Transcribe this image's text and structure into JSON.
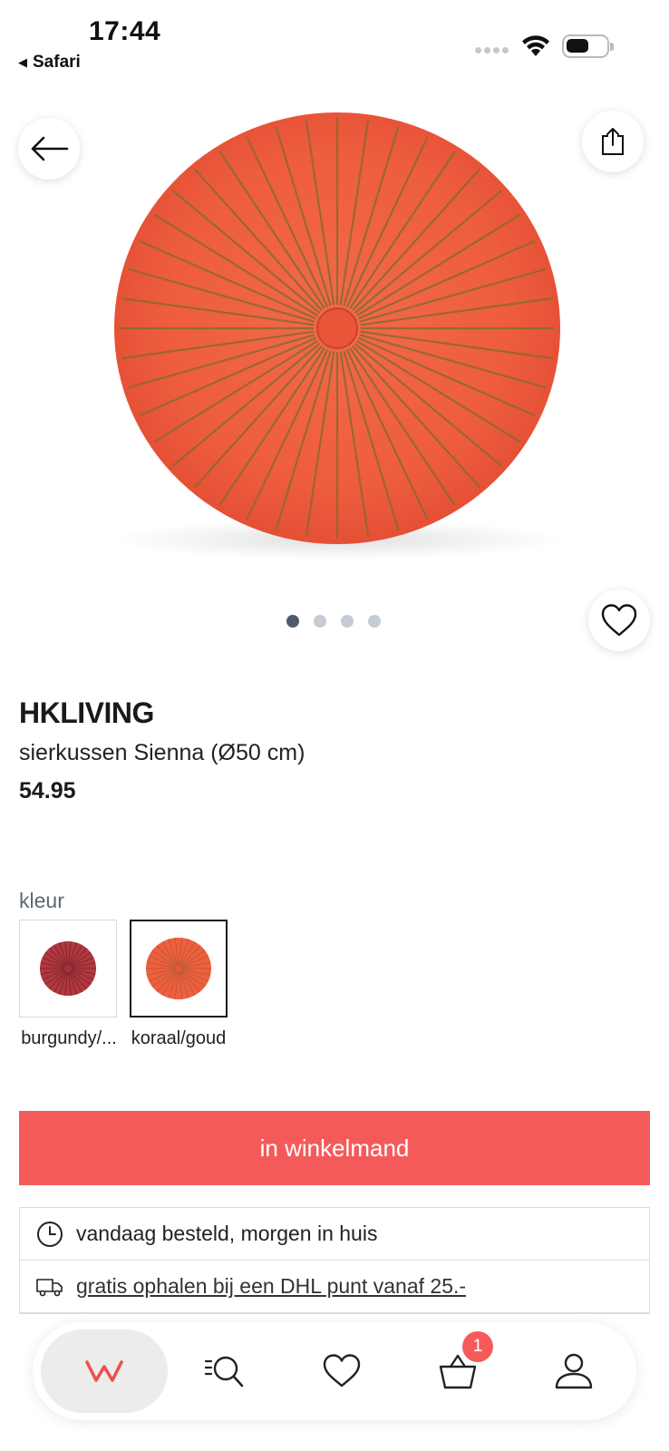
{
  "status_bar": {
    "time": "17:44",
    "back_app": "Safari",
    "back_arrow": "◀"
  },
  "product": {
    "brand": "HKLIVING",
    "name": "sierkussen Sienna (Ø50 cm)",
    "price": "54.95",
    "image_icon": "round-coral-cushion",
    "image_count": 4,
    "active_image_index": 0
  },
  "color_selector": {
    "label": "kleur",
    "options": [
      {
        "label": "burgundy/...",
        "swatch_color": "#b0383f",
        "selected": false
      },
      {
        "label": "koraal/goud",
        "swatch_color": "#ef5f3f",
        "selected": true
      }
    ]
  },
  "actions": {
    "add_to_cart_label": "in winkelmand",
    "accent_color": "#f55a5a"
  },
  "info": {
    "delivery_text": "vandaag besteld, morgen in huis",
    "delivery_icon": "clock-icon",
    "pickup_text": "gratis ophalen bij een DHL punt vanaf 25.-",
    "pickup_icon": "truck-icon"
  },
  "bottom_nav": {
    "home_logo": "w",
    "cart_count": "1",
    "items": [
      "home",
      "search",
      "favorites",
      "cart",
      "account"
    ]
  }
}
